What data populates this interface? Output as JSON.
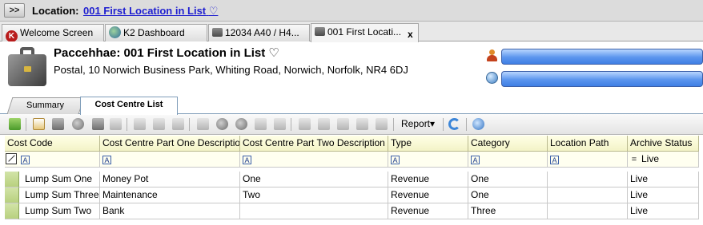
{
  "location_bar": {
    "expand_label": ">>",
    "label": "Location:",
    "link_text": "001 First Location in List"
  },
  "window_tabs": [
    {
      "label": "Welcome Screen"
    },
    {
      "label": "K2 Dashboard"
    },
    {
      "label": "12034 A40 / H4..."
    },
    {
      "label": "001 First Locati..."
    }
  ],
  "tab_close_label": "x",
  "record": {
    "title": "Paccehhae: 001 First Location in List",
    "address": "Postal, 10 Norwich Business Park, Whiting Road, Norwich, Norfolk, NR4 6DJ"
  },
  "section_tabs": [
    "Summary",
    "Cost Centre List"
  ],
  "toolbar": {
    "report_label": "Report",
    "report_arrow": "▾"
  },
  "grid": {
    "columns": [
      "Cost Code",
      "Cost Centre Part One Description",
      "Cost Centre Part Two Description",
      "Type",
      "Category",
      "Location Path",
      "Archive Status"
    ],
    "filter_marker": "A",
    "filter_archive_operator": "=",
    "filter_archive_value": "Live",
    "rows": [
      {
        "cost_code": "Lump Sum One",
        "part_one": "Money Pot",
        "part_two": "One",
        "type": "Revenue",
        "category": "One",
        "location_path": "",
        "archive_status": "Live"
      },
      {
        "cost_code": "Lump Sum Three",
        "part_one": "Maintenance",
        "part_two": "Two",
        "type": "Revenue",
        "category": "One",
        "location_path": "",
        "archive_status": "Live"
      },
      {
        "cost_code": "Lump Sum Two",
        "part_one": "Bank",
        "part_two": "",
        "type": "Revenue",
        "category": "Three",
        "location_path": "",
        "archive_status": "Live"
      }
    ]
  },
  "icons": {
    "heart": "♡"
  },
  "colors": {
    "link": "#1f1fd0",
    "header_bg": "#f3f3c7",
    "blue_field": "#5b95ee",
    "row_selector": "#b8d17e"
  }
}
